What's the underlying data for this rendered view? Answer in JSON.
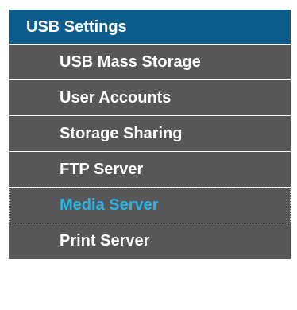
{
  "menu": {
    "header": "USB Settings",
    "items": [
      {
        "label": "USB Mass Storage"
      },
      {
        "label": "User Accounts"
      },
      {
        "label": "Storage Sharing"
      },
      {
        "label": "FTP Server"
      },
      {
        "label": "Media Server",
        "active": true
      },
      {
        "label": "Print Server"
      }
    ]
  },
  "colors": {
    "header_bg": "#0d5d8c",
    "item_bg": "#575757",
    "item_text": "#ffffff",
    "active_text": "#28b4e6"
  }
}
